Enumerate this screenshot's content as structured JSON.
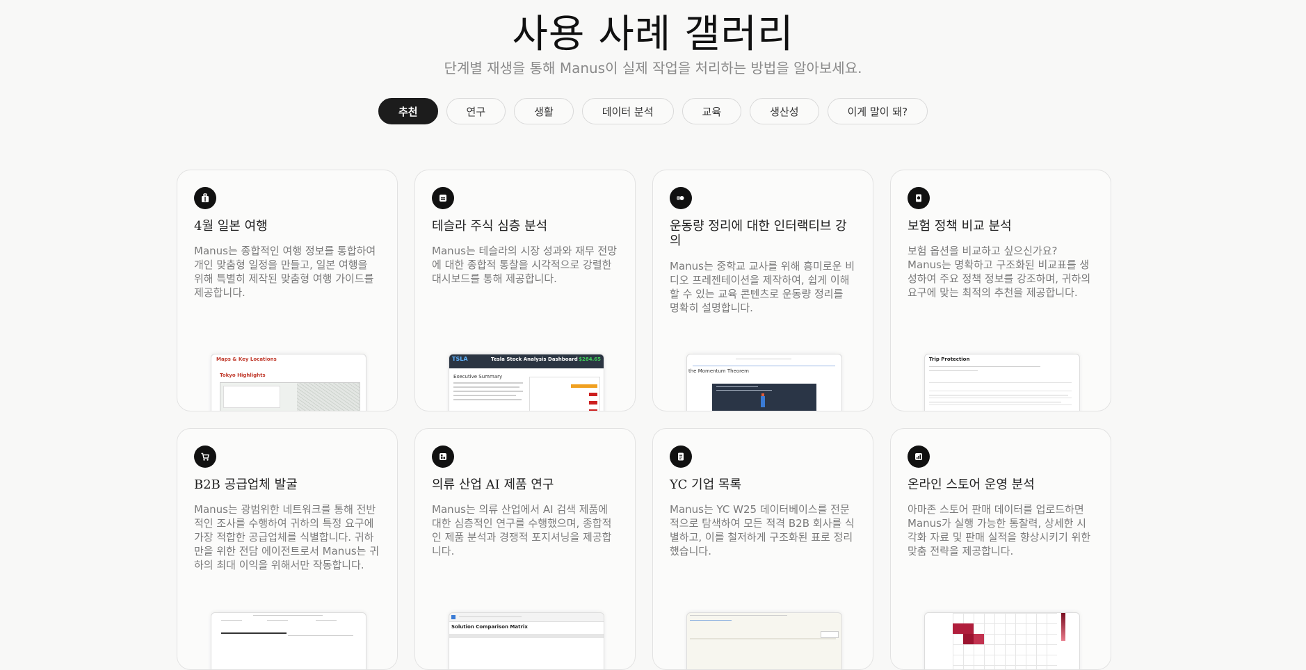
{
  "header": {
    "title": "사용 사례 갤러리",
    "subtitle": "단계별 재생을 통해 Manus이 실제 작업을 처리하는 방법을 알아보세요."
  },
  "tabs": [
    {
      "label": "추천",
      "active": true
    },
    {
      "label": "연구",
      "active": false
    },
    {
      "label": "생활",
      "active": false
    },
    {
      "label": "데이터 분석",
      "active": false
    },
    {
      "label": "교육",
      "active": false
    },
    {
      "label": "생산성",
      "active": false
    },
    {
      "label": "이게 말이 돼?",
      "active": false
    }
  ],
  "cards": [
    {
      "icon": "luggage-icon",
      "title": "4월 일본 여행",
      "description": "Manus는 종합적인 여행 정보를 통합하여 개인 맞춤형 일정을 만들고, 일본 여행을 위해 특별히 제작된 맞춤형 여행 가이드를 제공합니다.",
      "preview": {
        "heading": "Maps & Key Locations",
        "sub": "Tokyo Highlights"
      }
    },
    {
      "icon": "chart-box-icon",
      "title": "테슬라 주식 심층 분석",
      "description": "Manus는 테슬라의 시장 성과와 재무 전망에 대한 종합적 통찰을 시각적으로 강렬한 대시보드를 통해 제공합니다.",
      "preview": {
        "ticker": "TSLA",
        "heading": "Tesla Stock Analysis Dashboard",
        "price": "$284.65",
        "sub": "Executive Summary"
      }
    },
    {
      "icon": "momentum-icon",
      "title": "운동량 정리에 대한 인터랙티브 강의",
      "description": "Manus는 중학교 교사를 위해 흥미로운 비디오 프레젠테이션을 제작하여, 쉽게 이해할 수 있는 교육 콘텐츠로 운동량 정리를 명확히 설명합니다.",
      "preview": {
        "sub": "the Momentum Theorem"
      }
    },
    {
      "icon": "policy-icon",
      "title": "보험 정책 비교 분석",
      "description": "보험 옵션을 비교하고 싶으신가요? Manus는 명확하고 구조화된 비교표를 생성하여 주요 정책 정보를 강조하며, 귀하의 요구에 맞는 최적의 추천을 제공합니다.",
      "preview": {
        "heading": "Trip Protection"
      }
    },
    {
      "icon": "cart-icon",
      "title": "B2B 공급업체 발굴",
      "description": "Manus는 광범위한 네트워크를 통해 전반적인 조사를 수행하여 귀하의 특정 요구에 가장 적합한 공급업체를 식별합니다. 귀하만을 위한 전담 에이전트로서 Manus는 귀하의 최대 이익을 위해서만 작동합니다.",
      "preview": {}
    },
    {
      "icon": "research-icon",
      "title": "의류 산업 AI 제품 연구",
      "description": "Manus는 의류 산업에서 AI 검색 제품에 대한 심층적인 연구를 수행했으며, 종합적인 제품 분석과 경쟁적 포지셔닝을 제공합니다.",
      "preview": {
        "heading": "Solution Comparison Matrix"
      }
    },
    {
      "icon": "list-icon",
      "title": "YC 기업 목록",
      "description": "Manus는 YC W25 데이터베이스를 전문적으로 탐색하여 모든 적격 B2B 회사를 식별하고, 이를 철저하게 구조화된 표로 정리했습니다.",
      "preview": {}
    },
    {
      "icon": "bar-chart-icon",
      "title": "온라인 스토어 운영 분석",
      "description": "아마존 스토어 판매 데이터를 업로드하면 Manus가 실행 가능한 통찰력, 상세한 시각화 자료 및 판매 실적을 향상시키기 위한 맞춤 전략을 제공합니다.",
      "preview": {}
    }
  ],
  "colors": {
    "accent": "#111111",
    "muted_text": "#7a7a7a",
    "tesla_red": "#cc1f1f",
    "tesla_green": "#2e9c3f"
  }
}
